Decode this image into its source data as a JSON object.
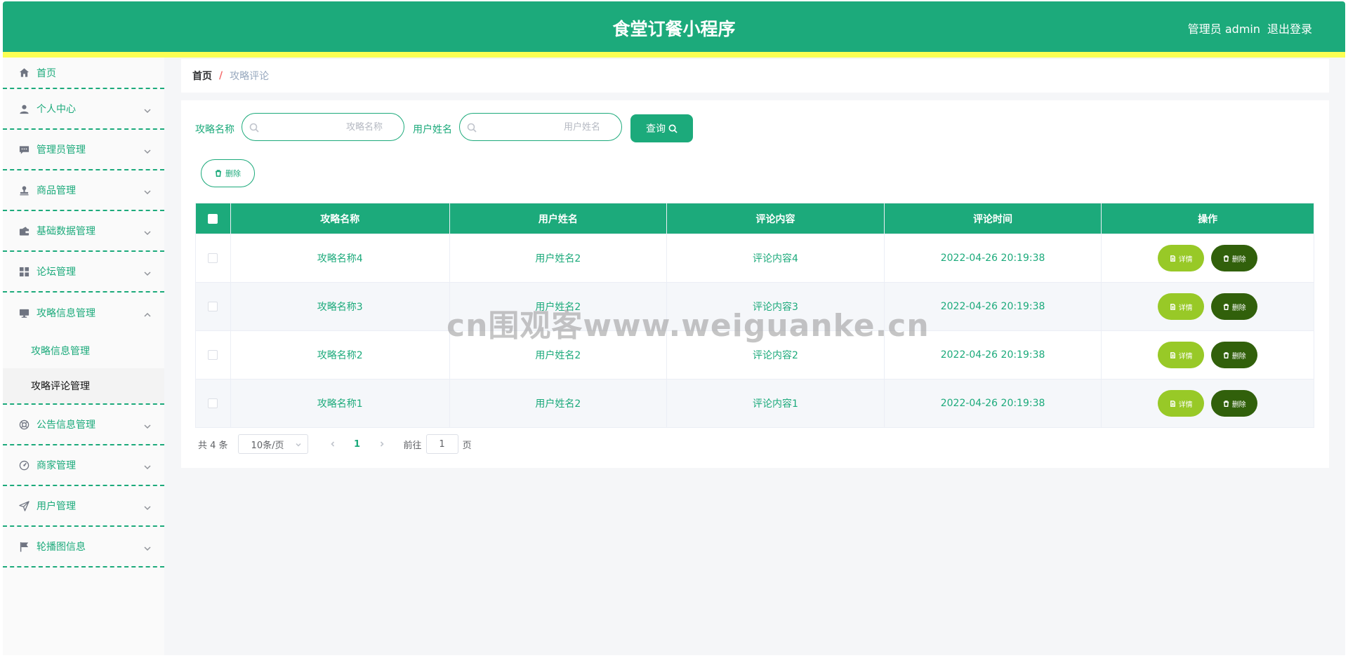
{
  "header": {
    "title": "食堂订餐小程序",
    "user": "管理员 admin",
    "logout": "退出登录"
  },
  "sidebar": {
    "items": [
      {
        "label": "首页",
        "icon": "home-icon"
      },
      {
        "label": "个人中心",
        "icon": "user-icon"
      },
      {
        "label": "管理员管理",
        "icon": "chat-icon"
      },
      {
        "label": "商品管理",
        "icon": "stamp-icon"
      },
      {
        "label": "基础数据管理",
        "icon": "wallet-icon"
      },
      {
        "label": "论坛管理",
        "icon": "grid-icon"
      },
      {
        "label": "攻略信息管理",
        "icon": "monitor-icon",
        "children": [
          "攻略信息管理",
          "攻略评论管理"
        ]
      },
      {
        "label": "公告信息管理",
        "icon": "help-icon"
      },
      {
        "label": "商家管理",
        "icon": "dashboard-icon"
      },
      {
        "label": "用户管理",
        "icon": "send-icon"
      },
      {
        "label": "轮播图信息",
        "icon": "flag-icon"
      }
    ]
  },
  "breadcrumb": {
    "home": "首页",
    "separator": "/",
    "current": "攻略评论"
  },
  "search": {
    "label1": "攻略名称",
    "placeholder1": "攻略名称",
    "label2": "用户姓名",
    "placeholder2": "用户姓名",
    "query": "查询"
  },
  "actions": {
    "delete": "删除"
  },
  "table": {
    "headers": [
      "攻略名称",
      "用户姓名",
      "评论内容",
      "评论时间",
      "操作"
    ],
    "rows": [
      {
        "name": "攻略名称4",
        "user": "用户姓名2",
        "content": "评论内容4",
        "time": "2022-04-26 20:19:38"
      },
      {
        "name": "攻略名称3",
        "user": "用户姓名2",
        "content": "评论内容3",
        "time": "2022-04-26 20:19:38"
      },
      {
        "name": "攻略名称2",
        "user": "用户姓名2",
        "content": "评论内容2",
        "time": "2022-04-26 20:19:38"
      },
      {
        "name": "攻略名称1",
        "user": "用户姓名2",
        "content": "评论内容1",
        "time": "2022-04-26 20:19:38"
      }
    ],
    "detail_label": "详情",
    "delete_label": "删除"
  },
  "pagination": {
    "total": "共 4 条",
    "page_size": "10条/页",
    "current_page": "1",
    "goto_prefix": "前往",
    "goto_value": "1",
    "goto_suffix": "页"
  },
  "watermark": "cn围观客www.weiguanke.cn",
  "colors": {
    "primary": "#1caa7b",
    "accent_bar": "#fbff53",
    "detail_button": "#98c927",
    "delete_button": "#31600b"
  }
}
